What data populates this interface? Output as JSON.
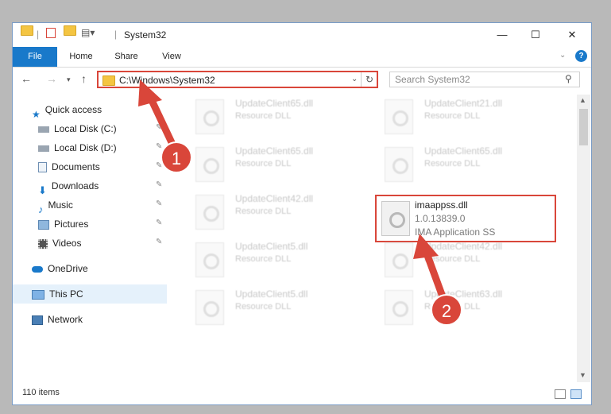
{
  "window": {
    "title": "System32"
  },
  "ribbon": {
    "tabs": [
      "File",
      "Home",
      "Share",
      "View"
    ]
  },
  "address": {
    "path": "C:\\Windows\\System32",
    "search_placeholder": "Search System32"
  },
  "nav": {
    "quick_access": "Quick access",
    "items": [
      "Local Disk (C:)",
      "Local Disk (D:)",
      "Documents",
      "Downloads",
      "Music",
      "Pictures",
      "Videos"
    ],
    "onedrive": "OneDrive",
    "this_pc": "This PC",
    "network": "Network"
  },
  "files": [
    {
      "name": "UpdateClient65.dll",
      "type": "Resource DLL"
    },
    {
      "name": "UpdateClient21.dll",
      "type": "Resource DLL"
    },
    {
      "name": "UpdateClient65.dll",
      "type": "Resource DLL"
    },
    {
      "name": "UpdateClient65.dll",
      "type": "Resource DLL"
    },
    {
      "name": "UpdateClient42.dll",
      "type": "Resource DLL"
    },
    {
      "name": "imaappss.dll",
      "version": "1.0.13839.0",
      "type": "IMA Application SS"
    },
    {
      "name": "UpdateClient5.dll",
      "type": "Resource DLL"
    },
    {
      "name": "UpdateClient42.dll",
      "type": "Resource DLL"
    },
    {
      "name": "UpdateClient5.dll",
      "type": "Resource DLL"
    },
    {
      "name": "UpdateClient63.dll",
      "type": "Resource DLL"
    }
  ],
  "status": {
    "count": "110 items"
  },
  "callouts": [
    "1",
    "2"
  ],
  "colors": {
    "accent": "#1979ca",
    "highlight": "#d9463a"
  }
}
